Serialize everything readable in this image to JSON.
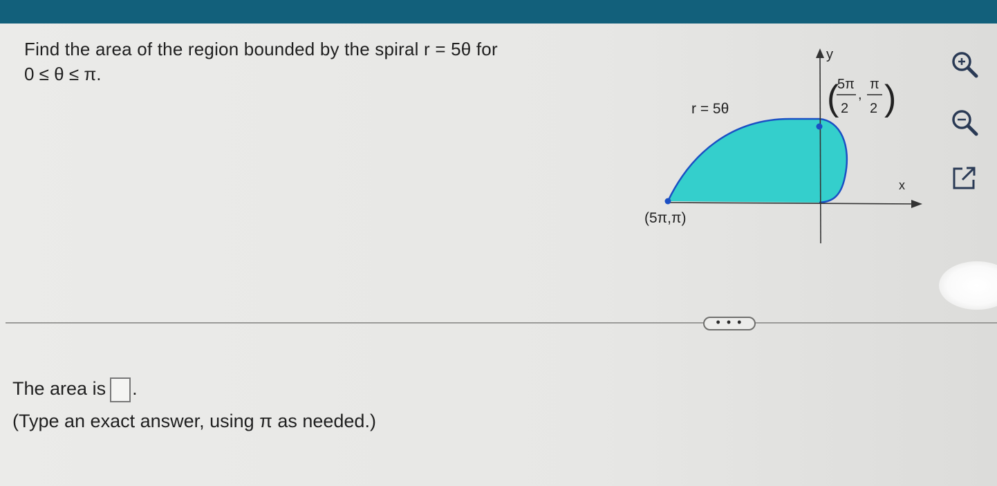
{
  "question": {
    "line1": "Find the area of the region bounded by the spiral r = 5θ for",
    "line2": "0 ≤ θ ≤ π."
  },
  "figure": {
    "y_label": "y",
    "x_label": "x",
    "curve_label": "r = 5θ",
    "point_left_label": "(5π,π)",
    "point_top_num1": "5π",
    "point_top_den1": "2",
    "point_top_num2": "π",
    "point_top_den2": "2",
    "fill_color": "#34cfcc",
    "curve_color": "#1b4fc4"
  },
  "tools": [
    "zoom-in-icon",
    "zoom-out-icon",
    "popout-icon"
  ],
  "more_button": "• • •",
  "answer": {
    "prefix": "The area is",
    "suffix": ".",
    "hint": "(Type an exact answer, using π as needed.)"
  }
}
